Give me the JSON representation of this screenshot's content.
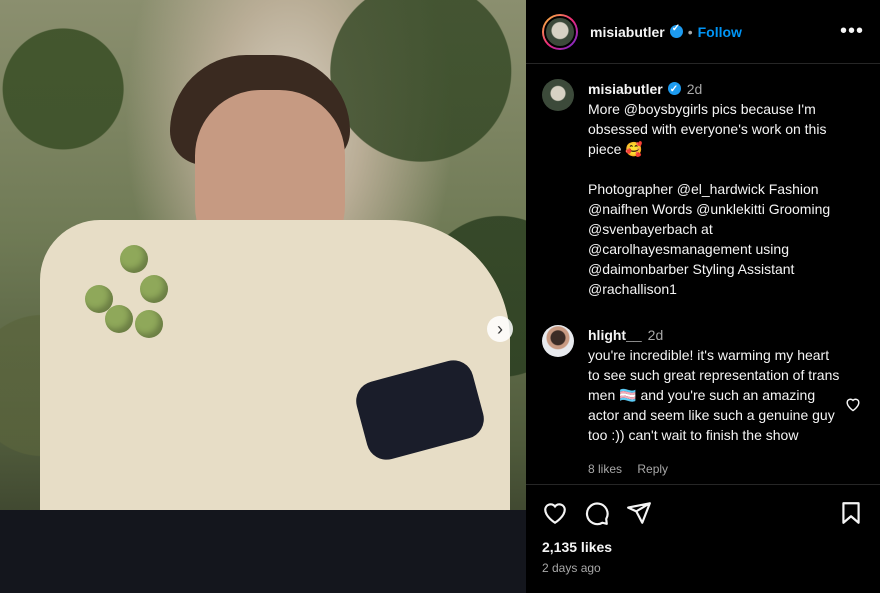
{
  "post": {
    "image_alt": "",
    "next_icon": "chevron-right-icon"
  },
  "header": {
    "username": "misiabutler",
    "separator": "•",
    "follow_label": "Follow",
    "more_label": "•••"
  },
  "caption": {
    "username": "misiabutler",
    "time": "2d",
    "lines": [
      "More @boysbygirls pics because I'm obsessed with everyone's work on this piece 🥰",
      "Photographer @el_hardwick Fashion @naifhen Words @unklekitti Grooming @svenbayerbach at @carolhayesmanagement using @daimonbarber Styling Assistant @rachallison1"
    ]
  },
  "comments": [
    {
      "username": "hlight__",
      "time": "2d",
      "text": "you're incredible! it's warming my heart to see such great representation of trans men 🏳️‍⚧️ and you're such an amazing actor and seem like such a genuine guy too :)) can't wait to finish the show",
      "likes": "8 likes",
      "reply_label": "Reply"
    }
  ],
  "stats": {
    "likes": "2,135 likes",
    "age": "2 days ago"
  },
  "colors": {
    "accent": "#0095f6",
    "verified": "#1d9bf0",
    "muted": "#a8a8a8",
    "background": "#000000"
  }
}
